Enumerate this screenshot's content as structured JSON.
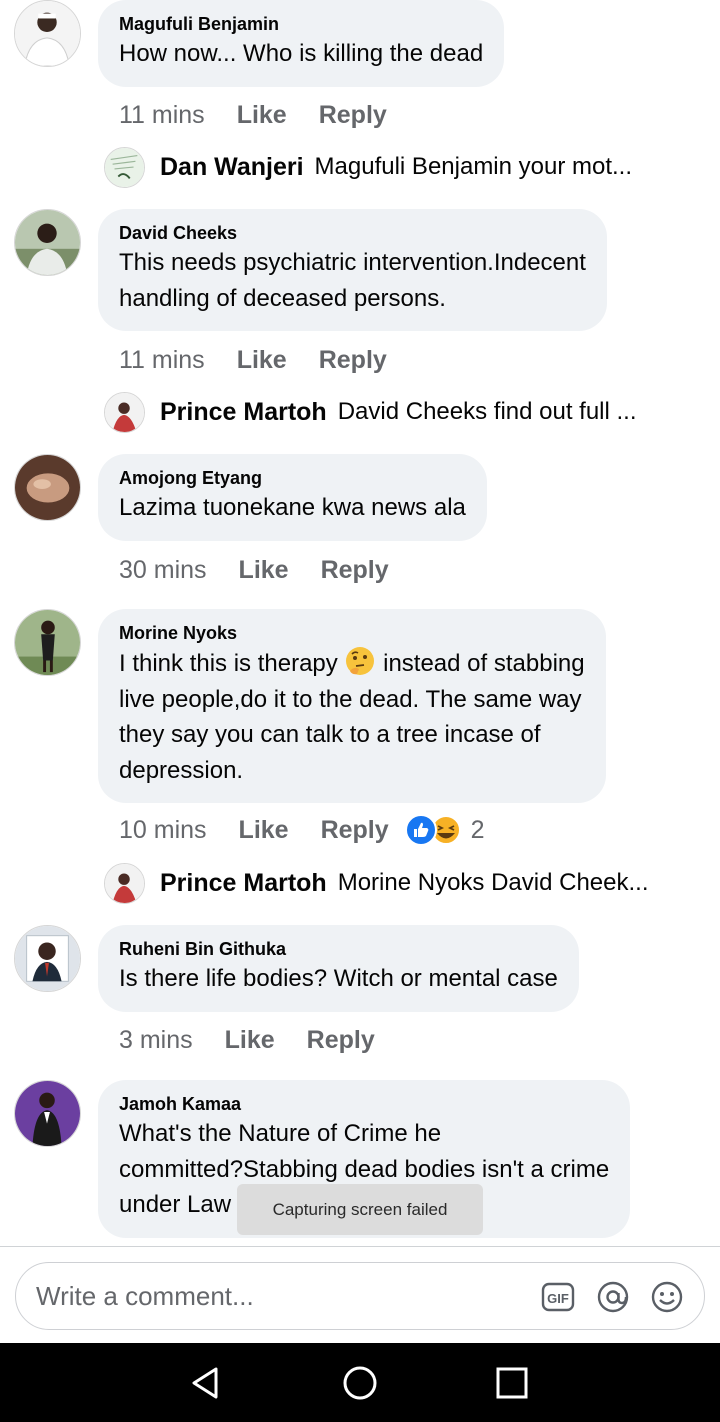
{
  "actions": {
    "like": "Like",
    "reply": "Reply"
  },
  "comments": [
    {
      "author": "Magufuli Benjamin",
      "text": "How now... Who is killing the dead",
      "time": "11 mins",
      "reply": {
        "name": "Dan Wanjeri",
        "text": "Magufuli Benjamin your mot..."
      }
    },
    {
      "author": "David Cheeks",
      "text_lines": [
        "This needs psychiatric intervention.Indecent",
        "handling of deceased persons."
      ],
      "time": "11 mins",
      "reply": {
        "name": "Prince Martoh",
        "text": "David Cheeks find out full ..."
      }
    },
    {
      "author": "Amojong Etyang",
      "text": "Lazima tuonekane kwa news ala",
      "time": "30 mins"
    },
    {
      "author": "Morine Nyoks",
      "line1_before": "I think this is therapy",
      "line1_after": "instead of stabbing",
      "text_lines": [
        "live people,do it to the dead. The same way",
        "they say you can talk to a tree incase of",
        "depression."
      ],
      "time": "10 mins",
      "reaction_count": "2",
      "reactions": [
        "like-icon",
        "haha-icon"
      ],
      "inline_emoji": "thinking-face-icon",
      "reply": {
        "name": "Prince Martoh",
        "text": "Morine Nyoks David Cheek..."
      }
    },
    {
      "author": "Ruheni Bin Githuka",
      "text": "Is there life bodies? Witch or mental case",
      "time": "3 mins"
    },
    {
      "author": "Jamoh Kamaa",
      "text_lines": [
        "What's the Nature of Crime he",
        "committed?Stabbing dead bodies isn't a crime",
        "under Law"
      ]
    }
  ],
  "toast": "Capturing screen failed",
  "composer": {
    "placeholder": "Write a comment...",
    "icons": [
      "gif-icon",
      "mention-icon",
      "emoji-icon"
    ]
  },
  "navbar": {
    "icons": [
      "back-icon",
      "home-icon",
      "recents-icon"
    ]
  },
  "colors": {
    "bubble": "#eff2f5",
    "meta": "#65676b",
    "like_blue": "#1877f2",
    "haha_yellow": "#f7b125",
    "navbar": "#000000"
  }
}
